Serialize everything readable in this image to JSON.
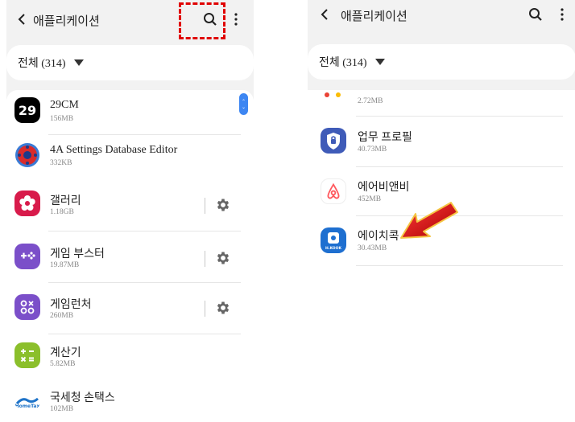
{
  "left_screen": {
    "header": {
      "title": "애플리케이션"
    },
    "filter": {
      "label": "전체 (314)"
    },
    "apps": [
      {
        "name": "29CM",
        "size": "156MB",
        "icon": "29cm-icon",
        "gear": false
      },
      {
        "name": "4A Settings Database Editor",
        "size": "332KB",
        "icon": "settings-db-icon",
        "gear": false
      },
      {
        "name": "갤러리",
        "size": "1.18GB",
        "icon": "gallery-icon",
        "gear": true
      },
      {
        "name": "게임 부스터",
        "size": "19.87MB",
        "icon": "game-booster-icon",
        "gear": true
      },
      {
        "name": "게임런처",
        "size": "260MB",
        "icon": "game-launcher-icon",
        "gear": true
      },
      {
        "name": "계산기",
        "size": "5.82MB",
        "icon": "calculator-icon",
        "gear": false
      },
      {
        "name": "국세청 손택스",
        "size": "102MB",
        "icon": "hometax-icon",
        "gear": false
      }
    ]
  },
  "right_screen": {
    "header": {
      "title": "애플리케이션"
    },
    "filter": {
      "label": "전체 (314)"
    },
    "partial_app": {
      "size": "2.72MB"
    },
    "apps": [
      {
        "name": "업무 프로필",
        "size": "40.73MB",
        "icon": "work-profile-icon"
      },
      {
        "name": "에어비앤비",
        "size": "452MB",
        "icon": "airbnb-icon"
      },
      {
        "name": "에이치콕",
        "size": "30.43MB",
        "icon": "h-kook-icon"
      }
    ]
  },
  "colors": {
    "highlight": "#e00000",
    "scroll_thumb": "#3d86f2",
    "arrow": "#d40000"
  }
}
